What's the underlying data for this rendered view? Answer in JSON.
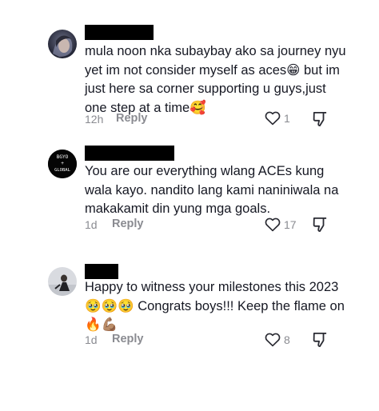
{
  "comments": [
    {
      "text": "mula noon nka subaybay ako sa journey nyu yet im not consider myself as aces😁 but im just here sa corner supporting u guys,just one step at a time🥰",
      "time": "12h",
      "reply_label": "Reply",
      "like_count": "1"
    },
    {
      "avatar_text": "BGYO\n+\nGLOBAL",
      "text": "You are our everything wlang ACEs kung wala kayo. nandito lang kami naniniwala na makakamit din yung mga goals.",
      "time": "1d",
      "reply_label": "Reply",
      "like_count": "17"
    },
    {
      "text": "Happy to witness your milestones this 2023 🥹🥹🥹 Congrats boys!!! Keep the flame on 🔥💪🏽",
      "time": "1d",
      "reply_label": "Reply",
      "like_count": "8"
    }
  ],
  "colors": {
    "text": "#161823",
    "muted": "#8a8b91",
    "redaction": "#000000"
  }
}
